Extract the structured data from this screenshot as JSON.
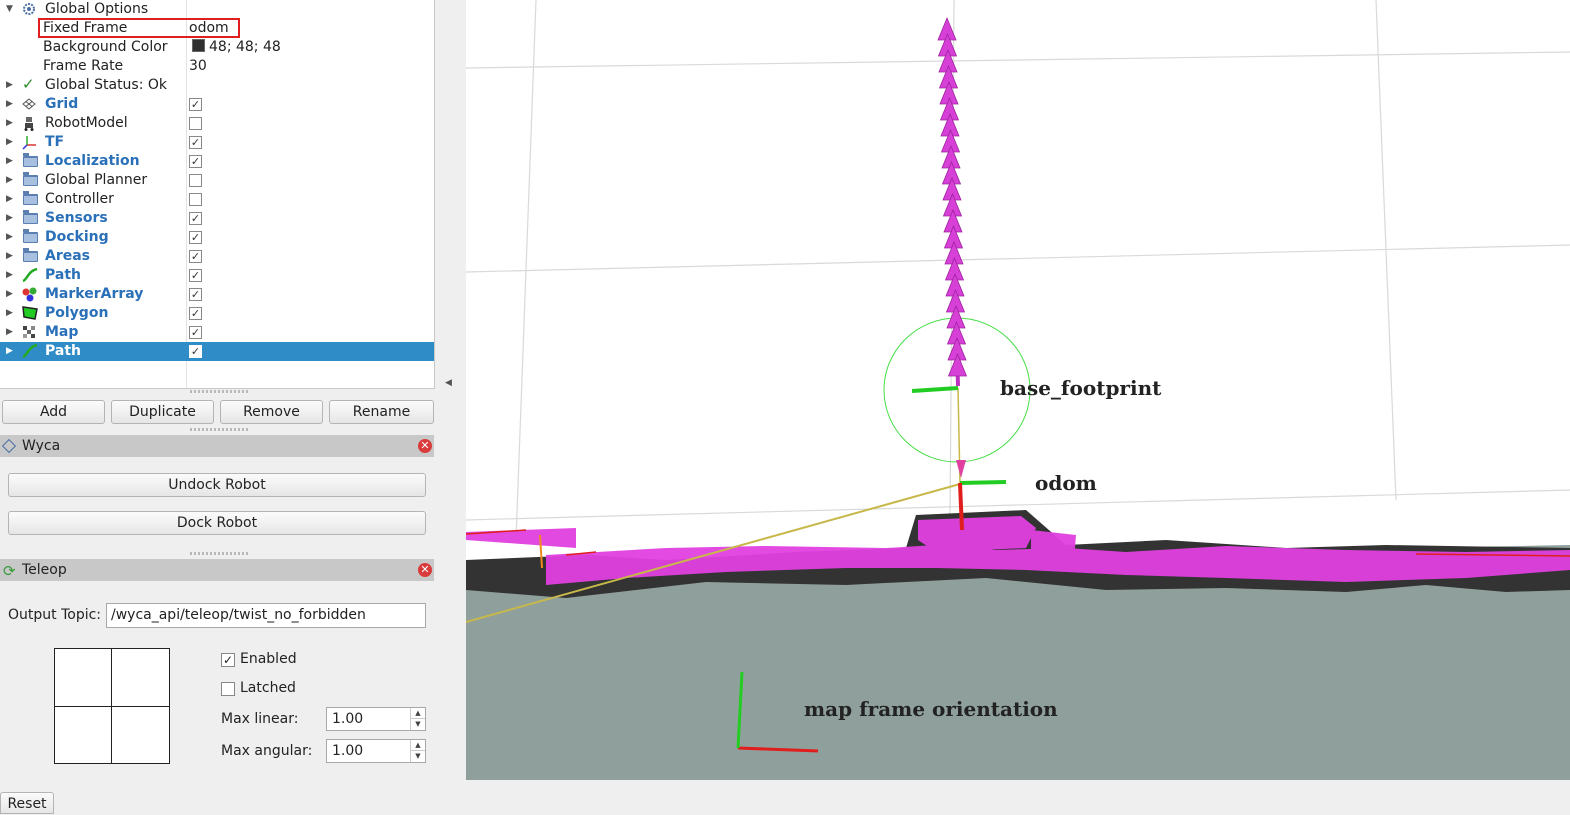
{
  "displays_tree": {
    "global_options": {
      "label": "Global Options",
      "fixed_frame": {
        "label": "Fixed Frame",
        "value": "odom"
      },
      "background_color": {
        "label": "Background Color",
        "value": "48; 48; 48"
      },
      "frame_rate": {
        "label": "Frame Rate",
        "value": "30"
      }
    },
    "global_status": "Global Status: Ok",
    "items": [
      {
        "label": "Grid",
        "checked": true,
        "icon": "grid-icon",
        "blue": true
      },
      {
        "label": "RobotModel",
        "checked": false,
        "icon": "robot-icon",
        "blue": false
      },
      {
        "label": "TF",
        "checked": true,
        "icon": "axes-icon",
        "blue": true
      },
      {
        "label": "Localization",
        "checked": true,
        "icon": "folder-icon",
        "blue": true
      },
      {
        "label": "Global Planner",
        "checked": false,
        "icon": "folder-icon",
        "blue": false
      },
      {
        "label": "Controller",
        "checked": false,
        "icon": "folder-icon",
        "blue": false
      },
      {
        "label": "Sensors",
        "checked": true,
        "icon": "folder-icon",
        "blue": true
      },
      {
        "label": "Docking",
        "checked": true,
        "icon": "folder-icon",
        "blue": true
      },
      {
        "label": "Areas",
        "checked": true,
        "icon": "folder-icon",
        "blue": true
      },
      {
        "label": "Path",
        "checked": true,
        "icon": "path-icon",
        "blue": true
      },
      {
        "label": "MarkerArray",
        "checked": true,
        "icon": "markers-icon",
        "blue": true
      },
      {
        "label": "Polygon",
        "checked": true,
        "icon": "polygon-icon",
        "blue": true
      },
      {
        "label": "Map",
        "checked": true,
        "icon": "map-icon",
        "blue": true
      },
      {
        "label": "Path",
        "checked": true,
        "icon": "path-icon",
        "blue": true,
        "selected": true
      }
    ]
  },
  "tree_buttons": {
    "add": "Add",
    "duplicate": "Duplicate",
    "remove": "Remove",
    "rename": "Rename"
  },
  "wyca_panel": {
    "title": "Wyca",
    "undock": "Undock Robot",
    "dock": "Dock Robot"
  },
  "teleop_panel": {
    "title": "Teleop",
    "output_topic_label": "Output Topic:",
    "output_topic_value": "/wyca_api/teleop/twist_no_forbidden",
    "enabled_label": "Enabled",
    "enabled": true,
    "latched_label": "Latched",
    "latched": false,
    "max_linear_label": "Max linear:",
    "max_linear": "1.00",
    "max_angular_label": "Max angular:",
    "max_angular": "1.00"
  },
  "reset_button": "Reset",
  "viewport": {
    "labels": {
      "base_footprint": "base_footprint",
      "odom": "odom",
      "map_frame": "map frame orientation"
    },
    "colors": {
      "ground": "#8fa09c",
      "path": "#e040e0",
      "obstacle": "#333333",
      "footprint": "#44dd44"
    }
  }
}
